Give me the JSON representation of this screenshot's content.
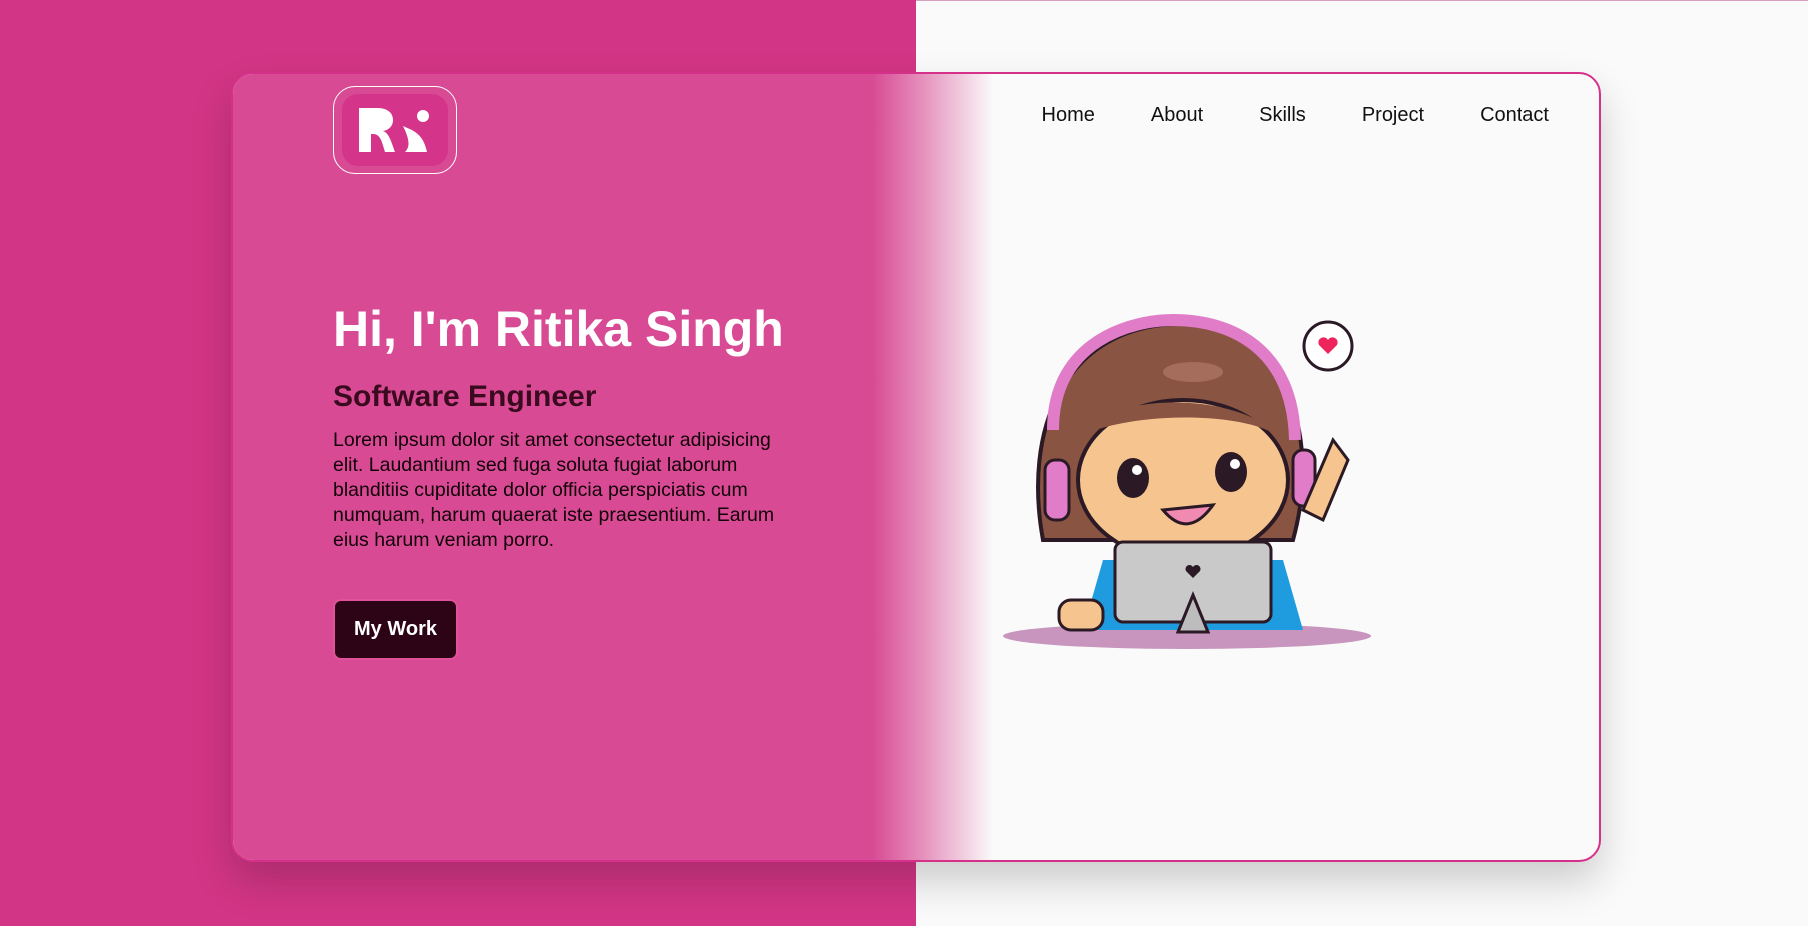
{
  "logo": {
    "text": "RS"
  },
  "nav": {
    "items": [
      "Home",
      "About",
      "Skills",
      "Project",
      "Contact"
    ]
  },
  "hero": {
    "greeting": "Hi, I'm Ritika Singh",
    "role": "Software Engineer",
    "description": "Lorem ipsum dolor sit amet consectetur adipisicing elit. Laudantium sed fuga soluta fugiat laborum blanditiis cupiditate dolor officia perspiciatis cum numquam, harum quaerat iste praesentium. Earum eius harum veniam porro.",
    "button": "My Work"
  },
  "colors": {
    "accent": "#d23585",
    "button": "#2d0416"
  }
}
